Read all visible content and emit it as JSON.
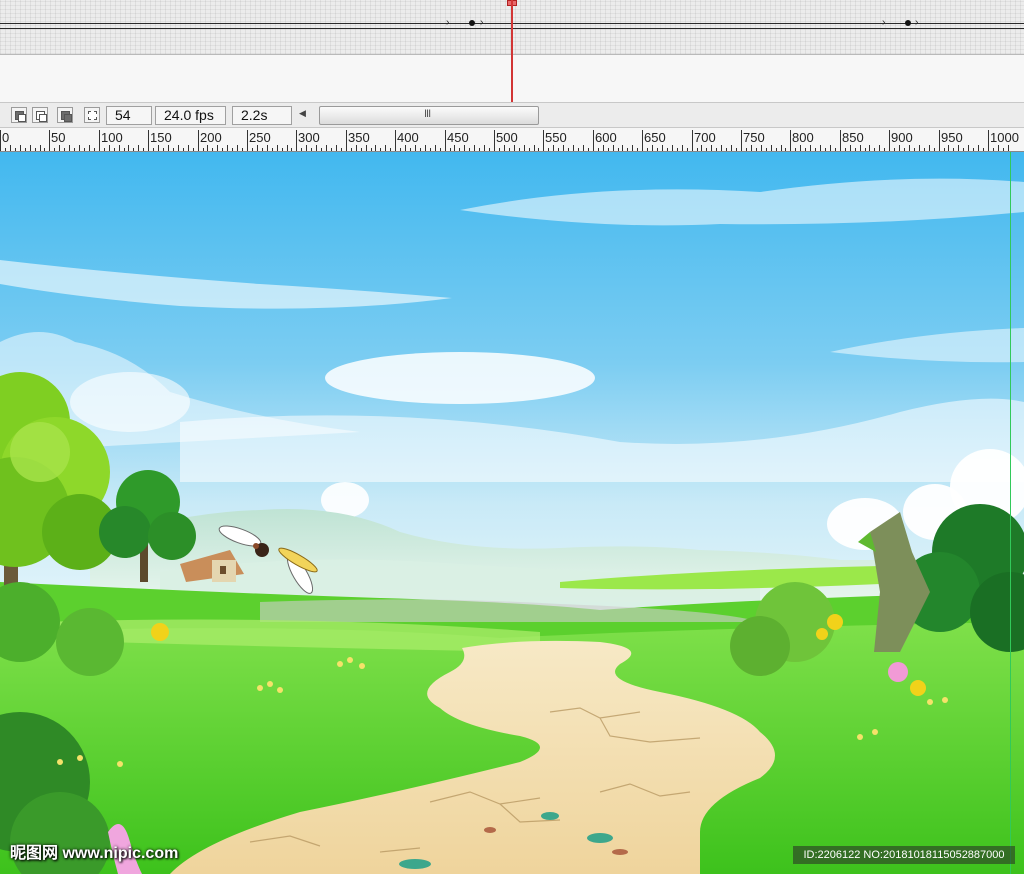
{
  "timeline": {
    "keyframes_row1": [
      472,
      908
    ],
    "arrows_row1": [
      449,
      483,
      885,
      918
    ]
  },
  "status_bar": {
    "current_frame": "54",
    "frame_rate": "24.0 fps",
    "elapsed_time": "2.2s",
    "buttons": [
      "onion-skin-icon",
      "onion-skin-outlines-icon",
      "edit-multiple-frames-icon",
      "modify-onion-markers-icon"
    ]
  },
  "ruler": {
    "labels": [
      "0",
      "50",
      "100",
      "150",
      "200",
      "250",
      "300",
      "350",
      "400",
      "450",
      "500",
      "550",
      "600",
      "650",
      "700",
      "750",
      "800",
      "850",
      "900",
      "950",
      "1000"
    ]
  },
  "colors": {
    "sky_top": "#4ec0f0",
    "sky_bottom": "#bfe6f7",
    "grass": "#5dd62c",
    "path": "#f2ddaf",
    "playhead": "#d23535",
    "guide": "#31c95a"
  },
  "watermark": {
    "left_text": "昵图网 www.nipic.com",
    "right_text": "ID:2206122 NO:20181018115052887000"
  }
}
